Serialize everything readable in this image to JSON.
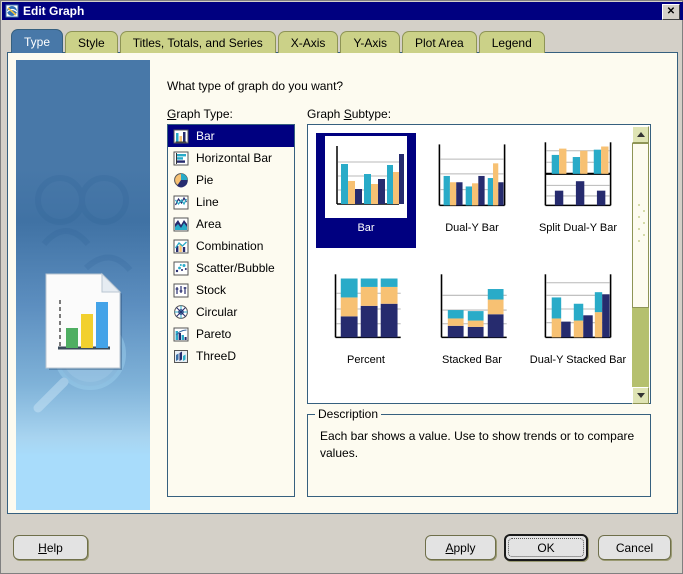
{
  "window": {
    "title": "Edit Graph",
    "title_icon": "graph-document-icon",
    "close_label": "✕"
  },
  "tabs": [
    {
      "label": "Type",
      "active": true
    },
    {
      "label": "Style",
      "active": false
    },
    {
      "label": "Titles, Totals, and Series",
      "active": false
    },
    {
      "label": "X-Axis",
      "active": false
    },
    {
      "label": "Y-Axis",
      "active": false
    },
    {
      "label": "Plot Area",
      "active": false
    },
    {
      "label": "Legend",
      "active": false
    }
  ],
  "main": {
    "question": "What type of graph do you want?",
    "graph_type_label": "Graph Type:",
    "graph_subtype_label": "Graph Subtype:"
  },
  "graph_types": [
    {
      "label": "Bar",
      "icon": "bar-chart-icon",
      "selected": true
    },
    {
      "label": "Horizontal Bar",
      "icon": "horizontal-bar-chart-icon",
      "selected": false
    },
    {
      "label": "Pie",
      "icon": "pie-chart-icon",
      "selected": false
    },
    {
      "label": "Line",
      "icon": "line-chart-icon",
      "selected": false
    },
    {
      "label": "Area",
      "icon": "area-chart-icon",
      "selected": false
    },
    {
      "label": "Combination",
      "icon": "combination-chart-icon",
      "selected": false
    },
    {
      "label": "Scatter/Bubble",
      "icon": "scatter-bubble-chart-icon",
      "selected": false
    },
    {
      "label": "Stock",
      "icon": "stock-chart-icon",
      "selected": false
    },
    {
      "label": "Circular",
      "icon": "circular-chart-icon",
      "selected": false
    },
    {
      "label": "Pareto",
      "icon": "pareto-chart-icon",
      "selected": false
    },
    {
      "label": "ThreeD",
      "icon": "threed-chart-icon",
      "selected": false
    }
  ],
  "graph_subtypes": [
    {
      "label": "Bar",
      "selected": true
    },
    {
      "label": "Dual-Y Bar",
      "selected": false
    },
    {
      "label": "Split Dual-Y Bar",
      "selected": false
    },
    {
      "label": "Percent",
      "selected": false
    },
    {
      "label": "Stacked Bar",
      "selected": false
    },
    {
      "label": "Dual-Y Stacked Bar",
      "selected": false
    }
  ],
  "description": {
    "legend": "Description",
    "text": "Each bar shows a value. Use to show trends or to compare values."
  },
  "buttons": {
    "help": "Help",
    "apply": "Apply",
    "ok": "OK",
    "cancel": "Cancel"
  },
  "colors": {
    "titlebar": "#000080",
    "tab_active": "#4878a8",
    "tab_inactive": "#cbd188",
    "panel_bg": "#fdfbf0",
    "selection": "#000080",
    "series_cyan": "#29abc8",
    "series_orange": "#f7c173",
    "series_navy": "#262b6e",
    "scrollbar_track": "#b5c06e"
  }
}
